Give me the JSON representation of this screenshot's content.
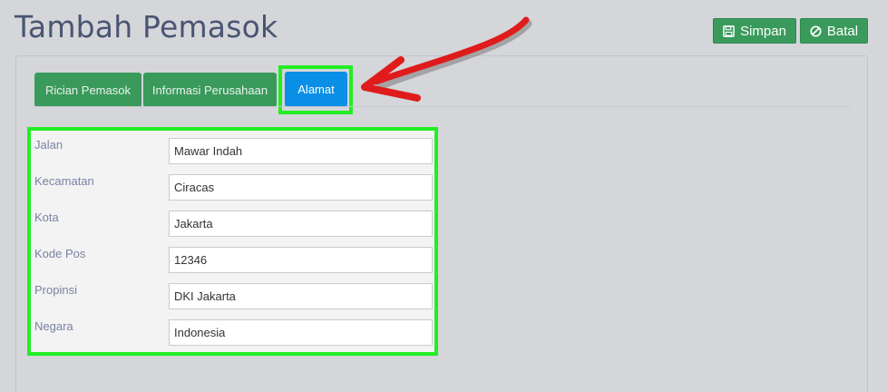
{
  "header": {
    "title": "Tambah Pemasok",
    "save_label": "Simpan",
    "cancel_label": "Batal"
  },
  "tabs": [
    {
      "label": "Rician Pemasok",
      "active": false
    },
    {
      "label": "Informasi Perusahaan",
      "active": false
    },
    {
      "label": "Alamat",
      "active": true
    }
  ],
  "form": {
    "fields": [
      {
        "label": "Jalan",
        "value": "Mawar Indah"
      },
      {
        "label": "Kecamatan",
        "value": "Ciracas"
      },
      {
        "label": "Kota",
        "value": "Jakarta"
      },
      {
        "label": "Kode Pos",
        "value": "12346"
      },
      {
        "label": "Propinsi",
        "value": "DKI Jakarta"
      },
      {
        "label": "Negara",
        "value": "Indonesia"
      }
    ]
  },
  "colors": {
    "button_green": "#3a9a5b",
    "active_tab_blue": "#0a8fe6",
    "highlight_green": "#22ee22",
    "arrow_red": "#e01b1b"
  },
  "icons": {
    "save": "floppy-disk-icon",
    "cancel": "ban-icon"
  }
}
